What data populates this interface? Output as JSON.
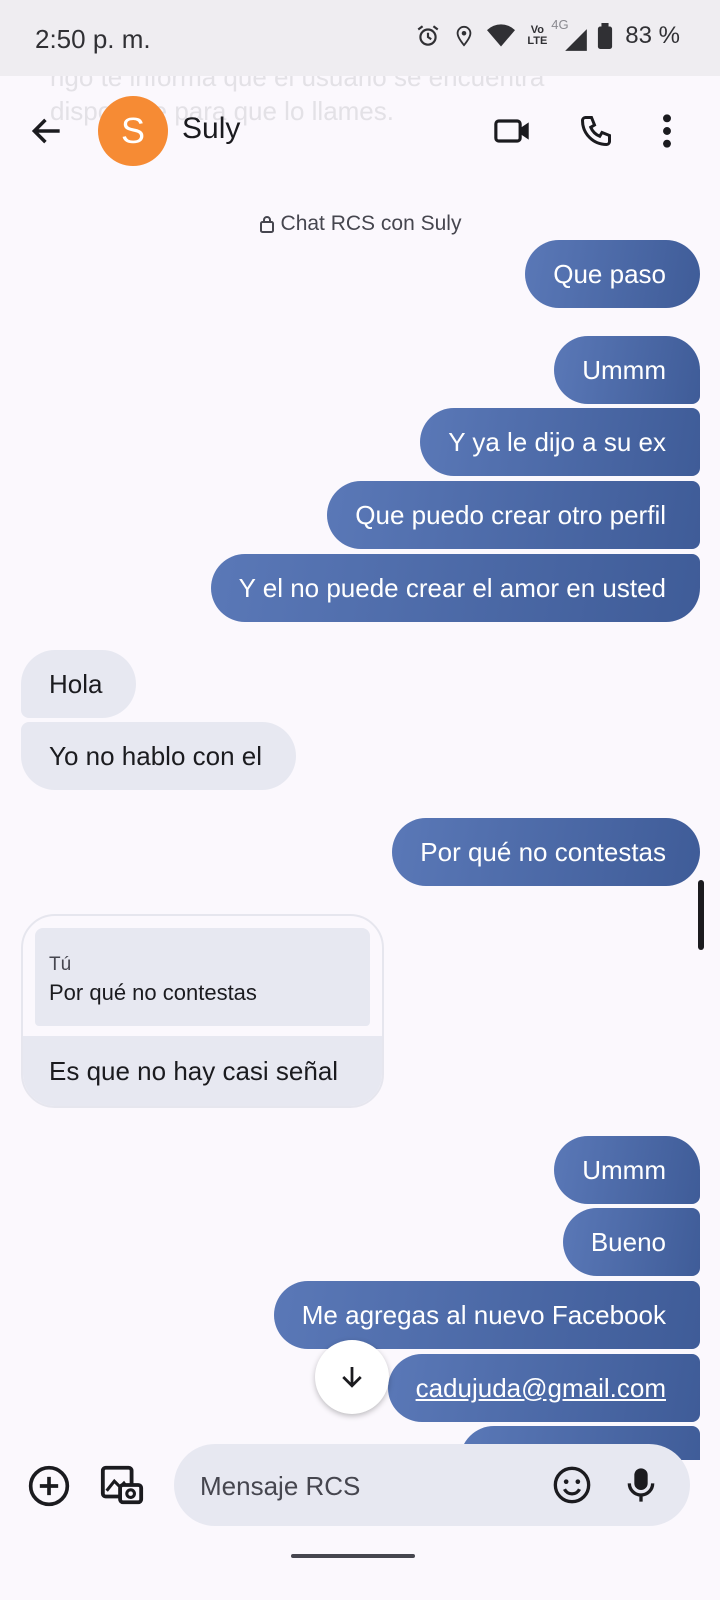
{
  "status": {
    "time": "2:50 p. m.",
    "battery": "83 %",
    "network": "4G",
    "volte": [
      "Vo",
      "LTE"
    ]
  },
  "header": {
    "ghost_lines": [
      "rigo te informa que el usuario se encuentra",
      "disponible para que lo llames."
    ],
    "avatar_letter": "S",
    "contact": "Suly"
  },
  "chat": {
    "rcs_note": "Chat RCS con Suly",
    "messages": [
      {
        "dir": "out",
        "text": "Que paso"
      },
      {
        "dir": "out",
        "text": "Ummm"
      },
      {
        "dir": "out",
        "text": "Y ya le dijo a su ex"
      },
      {
        "dir": "out",
        "text": "Que puedo crear otro perfil"
      },
      {
        "dir": "out",
        "text": "Y el no puede crear el amor en usted"
      },
      {
        "dir": "in",
        "text": "Hola"
      },
      {
        "dir": "in",
        "text": "Yo no hablo con el"
      },
      {
        "dir": "out",
        "text": "Por qué no contestas"
      },
      {
        "dir": "in",
        "reply_to": {
          "author": "Tú",
          "text": "Por qué no contestas"
        },
        "text": "Es que no hay casi señal"
      },
      {
        "dir": "out",
        "text": "Ummm"
      },
      {
        "dir": "out",
        "text": "Bueno"
      },
      {
        "dir": "out",
        "text": "Me agregas al nuevo Facebook"
      },
      {
        "dir": "out",
        "text": "cadujuda@gmail.com",
        "link": true
      }
    ]
  },
  "composer": {
    "placeholder": "Mensaje RCS"
  },
  "colors": {
    "outgoing": "#4a67a6",
    "incoming": "#e7e8f1",
    "avatar": "#f68b34",
    "background": "#fbf8fd"
  },
  "icons": [
    "back-arrow-icon",
    "video-call-icon",
    "phone-icon",
    "more-vert-icon",
    "lock-icon",
    "add-circle-icon",
    "gallery-icon",
    "emoji-icon",
    "mic-icon",
    "arrow-down-icon"
  ]
}
